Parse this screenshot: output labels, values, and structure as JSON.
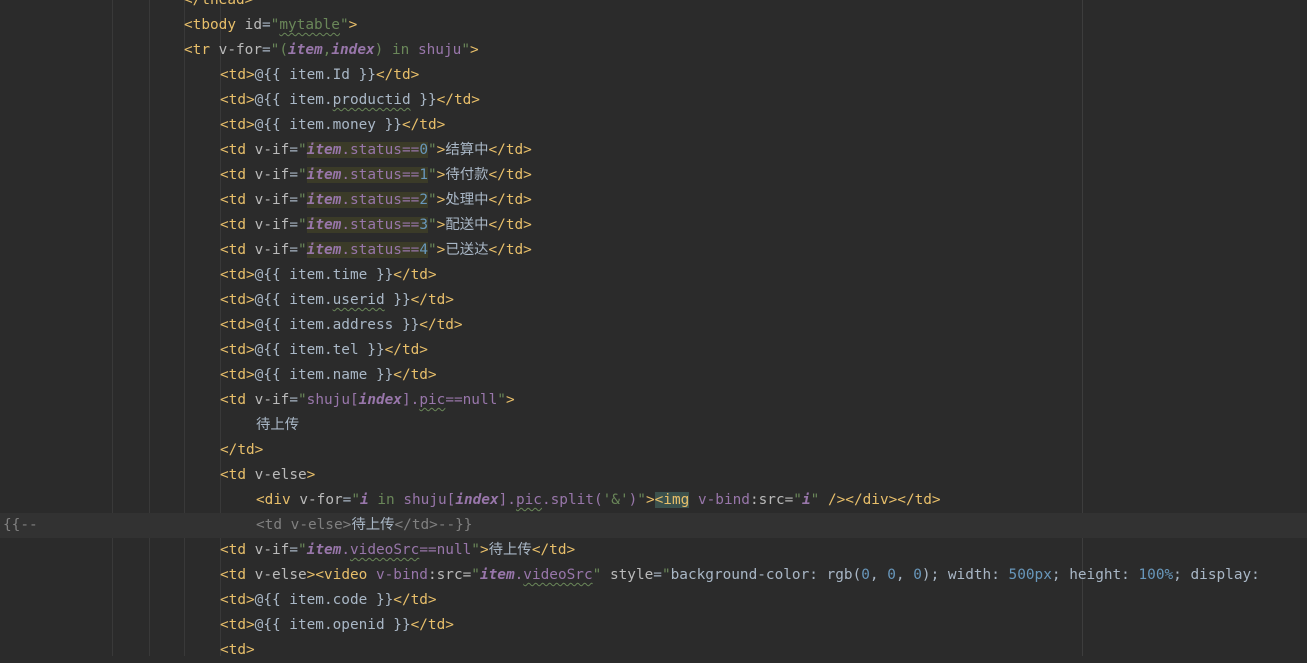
{
  "editor": {
    "colors": {
      "background": "#2b2b2b",
      "tag": "#e8bf6a",
      "string": "#6a8759",
      "variable": "#9876aa",
      "number": "#6897bb",
      "comment": "#808080"
    },
    "lines": [
      {
        "indent": 0,
        "segs": [
          [
            "tag",
            "</thead>"
          ]
        ]
      },
      {
        "indent": 0,
        "segs": [
          [
            "tag",
            "<tbody"
          ],
          [
            "plain",
            " "
          ],
          [
            "attr",
            "id"
          ],
          [
            "plain",
            "="
          ],
          [
            "str",
            "\""
          ],
          [
            "strsq",
            "mytable"
          ],
          [
            "str",
            "\""
          ],
          [
            "tag",
            ">"
          ]
        ]
      },
      {
        "indent": 0,
        "segs": [
          [
            "tag",
            "<tr"
          ],
          [
            "plain",
            " "
          ],
          [
            "attr",
            "v-for"
          ],
          [
            "plain",
            "="
          ],
          [
            "str",
            "\"("
          ],
          [
            "var",
            "item"
          ],
          [
            "str",
            ","
          ],
          [
            "var",
            "index"
          ],
          [
            "str",
            ") "
          ],
          [
            "str",
            "in"
          ],
          [
            "str",
            " "
          ],
          [
            "field",
            "shuju"
          ],
          [
            "str",
            "\""
          ],
          [
            "tag",
            ">"
          ]
        ]
      },
      {
        "indent": 1,
        "segs": [
          [
            "tag",
            "<td>"
          ],
          [
            "plain",
            "@{{ item.Id }}"
          ],
          [
            "tag",
            "</td>"
          ]
        ]
      },
      {
        "indent": 1,
        "segs": [
          [
            "tag",
            "<td>"
          ],
          [
            "plain",
            "@{{ item."
          ],
          [
            "plainsq",
            "productid"
          ],
          [
            "plain",
            " }}"
          ],
          [
            "tag",
            "</td>"
          ]
        ]
      },
      {
        "indent": 1,
        "segs": [
          [
            "tag",
            "<td>"
          ],
          [
            "plain",
            "@{{ item.money }}"
          ],
          [
            "tag",
            "</td>"
          ]
        ]
      },
      {
        "indent": 1,
        "segs": [
          [
            "tag",
            "<td"
          ],
          [
            "plain",
            " "
          ],
          [
            "attr",
            "v-if"
          ],
          [
            "plain",
            "="
          ],
          [
            "str",
            "\""
          ],
          [
            "varm",
            "item"
          ],
          [
            "fieldm",
            ".status=="
          ],
          [
            "numm",
            "0"
          ],
          [
            "str",
            "\""
          ],
          [
            "tag",
            ">"
          ],
          [
            "cjk",
            "结算中"
          ],
          [
            "tag",
            "</td>"
          ]
        ]
      },
      {
        "indent": 1,
        "segs": [
          [
            "tag",
            "<td"
          ],
          [
            "plain",
            " "
          ],
          [
            "attr",
            "v-if"
          ],
          [
            "plain",
            "="
          ],
          [
            "str",
            "\""
          ],
          [
            "varm",
            "item"
          ],
          [
            "fieldm",
            ".status=="
          ],
          [
            "numm",
            "1"
          ],
          [
            "str",
            "\""
          ],
          [
            "tag",
            ">"
          ],
          [
            "cjk",
            "待付款"
          ],
          [
            "tag",
            "</td>"
          ]
        ]
      },
      {
        "indent": 1,
        "segs": [
          [
            "tag",
            "<td"
          ],
          [
            "plain",
            " "
          ],
          [
            "attr",
            "v-if"
          ],
          [
            "plain",
            "="
          ],
          [
            "str",
            "\""
          ],
          [
            "varm",
            "item"
          ],
          [
            "fieldm",
            ".status=="
          ],
          [
            "numm",
            "2"
          ],
          [
            "str",
            "\""
          ],
          [
            "tag",
            ">"
          ],
          [
            "cjk",
            "处理中"
          ],
          [
            "tag",
            "</td>"
          ]
        ]
      },
      {
        "indent": 1,
        "segs": [
          [
            "tag",
            "<td"
          ],
          [
            "plain",
            " "
          ],
          [
            "attr",
            "v-if"
          ],
          [
            "plain",
            "="
          ],
          [
            "str",
            "\""
          ],
          [
            "varm",
            "item"
          ],
          [
            "fieldm",
            ".status=="
          ],
          [
            "numm",
            "3"
          ],
          [
            "str",
            "\""
          ],
          [
            "tag",
            ">"
          ],
          [
            "cjk",
            "配送中"
          ],
          [
            "tag",
            "</td>"
          ]
        ]
      },
      {
        "indent": 1,
        "segs": [
          [
            "tag",
            "<td"
          ],
          [
            "plain",
            " "
          ],
          [
            "attr",
            "v-if"
          ],
          [
            "plain",
            "="
          ],
          [
            "str",
            "\""
          ],
          [
            "varm",
            "item"
          ],
          [
            "fieldm",
            ".status=="
          ],
          [
            "numm",
            "4"
          ],
          [
            "str",
            "\""
          ],
          [
            "tag",
            ">"
          ],
          [
            "cjk",
            "已送达"
          ],
          [
            "tag",
            "</td>"
          ]
        ]
      },
      {
        "indent": 1,
        "segs": [
          [
            "tag",
            "<td>"
          ],
          [
            "plain",
            "@{{ item.time }}"
          ],
          [
            "tag",
            "</td>"
          ]
        ]
      },
      {
        "indent": 1,
        "segs": [
          [
            "tag",
            "<td>"
          ],
          [
            "plain",
            "@{{ item."
          ],
          [
            "plainsq",
            "userid"
          ],
          [
            "plain",
            " }}"
          ],
          [
            "tag",
            "</td>"
          ]
        ]
      },
      {
        "indent": 1,
        "segs": [
          [
            "tag",
            "<td>"
          ],
          [
            "plain",
            "@{{ item.address }}"
          ],
          [
            "tag",
            "</td>"
          ]
        ]
      },
      {
        "indent": 1,
        "segs": [
          [
            "tag",
            "<td>"
          ],
          [
            "plain",
            "@{{ item.tel }}"
          ],
          [
            "tag",
            "</td>"
          ]
        ]
      },
      {
        "indent": 1,
        "segs": [
          [
            "tag",
            "<td>"
          ],
          [
            "plain",
            "@{{ item.name }}"
          ],
          [
            "tag",
            "</td>"
          ]
        ]
      },
      {
        "indent": 1,
        "segs": [
          [
            "tag",
            "<td"
          ],
          [
            "plain",
            " "
          ],
          [
            "attr",
            "v-if"
          ],
          [
            "plain",
            "="
          ],
          [
            "str",
            "\""
          ],
          [
            "field",
            "shuju["
          ],
          [
            "var",
            "index"
          ],
          [
            "field",
            "]."
          ],
          [
            "fieldsq",
            "pic"
          ],
          [
            "field",
            "==null"
          ],
          [
            "str",
            "\""
          ],
          [
            "tag",
            ">"
          ]
        ]
      },
      {
        "indent": 2,
        "segs": [
          [
            "cjk",
            "待上传"
          ]
        ]
      },
      {
        "indent": 1,
        "segs": [
          [
            "tag",
            "</td>"
          ]
        ]
      },
      {
        "indent": 1,
        "segs": [
          [
            "tag",
            "<td"
          ],
          [
            "plain",
            " "
          ],
          [
            "attr",
            "v-else"
          ],
          [
            "tag",
            ">"
          ]
        ]
      },
      {
        "indent": 2,
        "segs": [
          [
            "tag",
            "<div"
          ],
          [
            "plain",
            " "
          ],
          [
            "attr",
            "v-for"
          ],
          [
            "plain",
            "="
          ],
          [
            "str",
            "\""
          ],
          [
            "var",
            "i"
          ],
          [
            "str",
            " in "
          ],
          [
            "field",
            "shuju["
          ],
          [
            "var",
            "index"
          ],
          [
            "field",
            "]."
          ],
          [
            "fieldsq",
            "pic"
          ],
          [
            "field",
            ".split("
          ],
          [
            "str",
            "'&'"
          ],
          [
            "field",
            ")"
          ],
          [
            "str",
            "\""
          ],
          [
            "tag",
            ">"
          ],
          [
            "tagm",
            "<img"
          ],
          [
            "plain",
            " "
          ],
          [
            "field",
            "v-bind"
          ],
          [
            "attr",
            ":src="
          ],
          [
            "str",
            "\""
          ],
          [
            "var",
            "i"
          ],
          [
            "str",
            "\""
          ],
          [
            "plain",
            " "
          ],
          [
            "tag",
            "/>"
          ],
          [
            "tag",
            "</div>"
          ],
          [
            "tag",
            "</td>"
          ]
        ]
      },
      {
        "indent": 2,
        "hl": true,
        "marker": "{{--",
        "segs": [
          [
            "cm",
            "<td v-else>"
          ],
          [
            "cmcjk",
            "待上传"
          ],
          [
            "cm",
            "</td>--}}"
          ]
        ]
      },
      {
        "indent": 1,
        "segs": [
          [
            "tag",
            "<td"
          ],
          [
            "plain",
            " "
          ],
          [
            "attr",
            "v-if"
          ],
          [
            "plain",
            "="
          ],
          [
            "str",
            "\""
          ],
          [
            "var",
            "item"
          ],
          [
            "field",
            "."
          ],
          [
            "fieldsq",
            "videoSrc"
          ],
          [
            "field",
            "==null"
          ],
          [
            "str",
            "\""
          ],
          [
            "tag",
            ">"
          ],
          [
            "cjk",
            "待上传"
          ],
          [
            "tag",
            "</td>"
          ]
        ]
      },
      {
        "indent": 1,
        "segs": [
          [
            "tag",
            "<td"
          ],
          [
            "plain",
            " "
          ],
          [
            "attr",
            "v-else"
          ],
          [
            "tag",
            ">"
          ],
          [
            "tag",
            "<video"
          ],
          [
            "plain",
            " "
          ],
          [
            "field",
            "v-bind"
          ],
          [
            "attr",
            ":src="
          ],
          [
            "str",
            "\""
          ],
          [
            "var",
            "item"
          ],
          [
            "field",
            "."
          ],
          [
            "fieldsq",
            "videoSrc"
          ],
          [
            "str",
            "\""
          ],
          [
            "plain",
            " "
          ],
          [
            "attr",
            "style"
          ],
          [
            "plain",
            "="
          ],
          [
            "str",
            "\""
          ],
          [
            "plain",
            "background-color: rgb("
          ],
          [
            "num",
            "0"
          ],
          [
            "plain",
            ", "
          ],
          [
            "num",
            "0"
          ],
          [
            "plain",
            ", "
          ],
          [
            "num",
            "0"
          ],
          [
            "plain",
            "); width: "
          ],
          [
            "num",
            "500px"
          ],
          [
            "plain",
            "; height: "
          ],
          [
            "num",
            "100%"
          ],
          [
            "plain",
            "; display:"
          ]
        ]
      },
      {
        "indent": 1,
        "segs": [
          [
            "tag",
            "<td>"
          ],
          [
            "plain",
            "@{{ item.code }}"
          ],
          [
            "tag",
            "</td>"
          ]
        ]
      },
      {
        "indent": 1,
        "segs": [
          [
            "tag",
            "<td>"
          ],
          [
            "plain",
            "@{{ item.openid }}"
          ],
          [
            "tag",
            "</td>"
          ]
        ]
      },
      {
        "indent": 1,
        "segs": [
          [
            "tag",
            "<td>"
          ]
        ]
      }
    ]
  }
}
